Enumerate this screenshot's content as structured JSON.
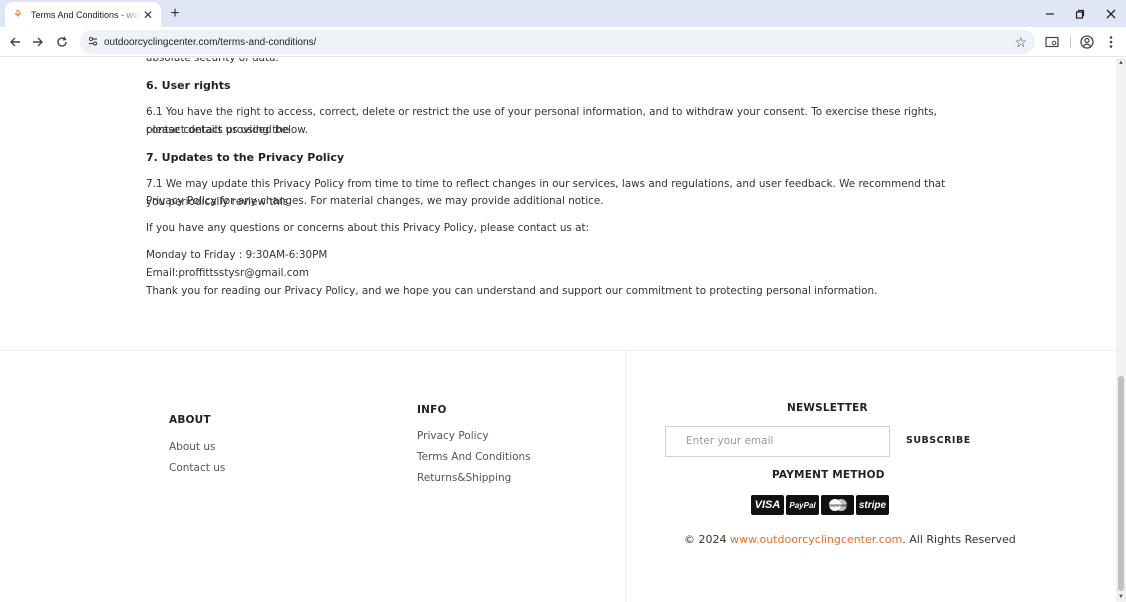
{
  "browser": {
    "tab_title": "Terms And Conditions - www.outdoorcyclingcenter.com",
    "url": "outdoorcyclingcenter.com/terms-and-conditions/"
  },
  "article": {
    "cut_line": "absolute security of data.",
    "h6": "6. User rights",
    "p61_a": "6.1 You have the right to access, correct, delete or restrict the use of your personal information, and to withdraw your consent. To exercise these rights, please contact us using the",
    "p61_b": "contact details provided below.",
    "h7": "7. Updates to the Privacy Policy",
    "p71_a": "7.1 We may update this Privacy Policy from time to time to reflect changes in our services, laws and regulations, and user feedback. We recommend that you periodically review this",
    "p71_b": "Privacy Policy for any changes. For material changes, we may provide additional notice.",
    "questions": "If you have any questions or concerns about this Privacy Policy, please contact us at:",
    "hours": "Monday to Friday : 9:30AM-6:30PM",
    "email": "Email:proffittsstysr@gmail.com",
    "thanks": "Thank you for reading our Privacy Policy, and we hope you can understand and support our commitment to protecting personal information."
  },
  "footer": {
    "about": {
      "heading": "ABOUT",
      "links": [
        "About us",
        "Contact us"
      ]
    },
    "info": {
      "heading": "INFO",
      "links": [
        "Privacy Policy",
        "Terms And Conditions",
        "Returns&Shipping"
      ]
    },
    "newsletter": {
      "heading": "NEWSLETTER",
      "placeholder": "Enter your email",
      "button": "SUBSCRIBE"
    },
    "payment": {
      "heading": "PAYMENT METHOD",
      "cards": [
        "VISA",
        "PayPal",
        "mastercard",
        "stripe"
      ]
    },
    "copyright": {
      "prefix": "© 2024",
      "site": "www.outdoorcyclingcenter.com",
      "suffix": ". All Rights Reserved"
    }
  },
  "colors": {
    "link_accent": "#e0712e",
    "tabbar": "#dfe6f6"
  }
}
